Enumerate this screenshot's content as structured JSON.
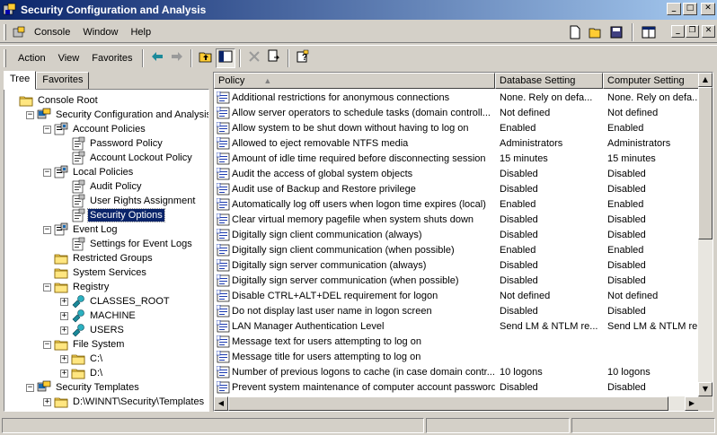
{
  "window": {
    "title": "Security Configuration and Analysis"
  },
  "menu": {
    "items": [
      "Console",
      "Window",
      "Help"
    ]
  },
  "action_menu": {
    "items": [
      "Action",
      "View",
      "Favorites"
    ]
  },
  "tabs": [
    "Tree",
    "Favorites"
  ],
  "tree": [
    {
      "label": "Console Root"
    },
    {
      "label": "Security Configuration and Analysis"
    },
    {
      "label": "Account Policies"
    },
    {
      "label": "Password Policy"
    },
    {
      "label": "Account Lockout Policy"
    },
    {
      "label": "Local Policies"
    },
    {
      "label": "Audit Policy"
    },
    {
      "label": "User Rights Assignment"
    },
    {
      "label": "Security Options",
      "selected": true
    },
    {
      "label": "Event Log"
    },
    {
      "label": "Settings for Event Logs"
    },
    {
      "label": "Restricted Groups"
    },
    {
      "label": "System Services"
    },
    {
      "label": "Registry"
    },
    {
      "label": "CLASSES_ROOT"
    },
    {
      "label": "MACHINE"
    },
    {
      "label": "USERS"
    },
    {
      "label": "File System"
    },
    {
      "label": "C:\\"
    },
    {
      "label": "D:\\"
    },
    {
      "label": "Security Templates"
    },
    {
      "label": "D:\\WINNT\\Security\\Templates"
    }
  ],
  "list": {
    "columns": [
      "Policy",
      "Database Setting",
      "Computer Setting"
    ],
    "rows": [
      [
        "Additional restrictions for anonymous connections",
        "None. Rely on defa...",
        "None. Rely on defa..."
      ],
      [
        "Allow server operators to schedule tasks (domain controll...",
        "Not defined",
        "Not defined"
      ],
      [
        "Allow system to be shut down without having to log on",
        "Enabled",
        "Enabled"
      ],
      [
        "Allowed to eject removable NTFS media",
        "Administrators",
        "Administrators"
      ],
      [
        "Amount of idle time required before disconnecting session",
        "15 minutes",
        "15 minutes"
      ],
      [
        "Audit the access of global system objects",
        "Disabled",
        "Disabled"
      ],
      [
        "Audit use of Backup and Restore privilege",
        "Disabled",
        "Disabled"
      ],
      [
        "Automatically log off users when logon time expires (local)",
        "Enabled",
        "Enabled"
      ],
      [
        "Clear virtual memory pagefile when system shuts down",
        "Disabled",
        "Disabled"
      ],
      [
        "Digitally sign client communication (always)",
        "Disabled",
        "Disabled"
      ],
      [
        "Digitally sign client communication (when possible)",
        "Enabled",
        "Enabled"
      ],
      [
        "Digitally sign server communication (always)",
        "Disabled",
        "Disabled"
      ],
      [
        "Digitally sign server communication (when possible)",
        "Disabled",
        "Disabled"
      ],
      [
        "Disable CTRL+ALT+DEL requirement for logon",
        "Not defined",
        "Not defined"
      ],
      [
        "Do not display last user name in logon screen",
        "Disabled",
        "Disabled"
      ],
      [
        "LAN Manager Authentication Level",
        "Send LM & NTLM re...",
        "Send LM & NTLM re..."
      ],
      [
        "Message text for users attempting to log on",
        "",
        ""
      ],
      [
        "Message title for users attempting to log on",
        "",
        ""
      ],
      [
        "Number of previous logons to cache (in case domain contr...",
        "10 logons",
        "10 logons"
      ],
      [
        "Prevent system maintenance of computer account password",
        "Disabled",
        "Disabled"
      ]
    ]
  },
  "colors": {
    "title_start": "#0a246a",
    "title_end": "#a6caf0",
    "selection": "#0a246a",
    "chrome": "#d4d0c8"
  }
}
